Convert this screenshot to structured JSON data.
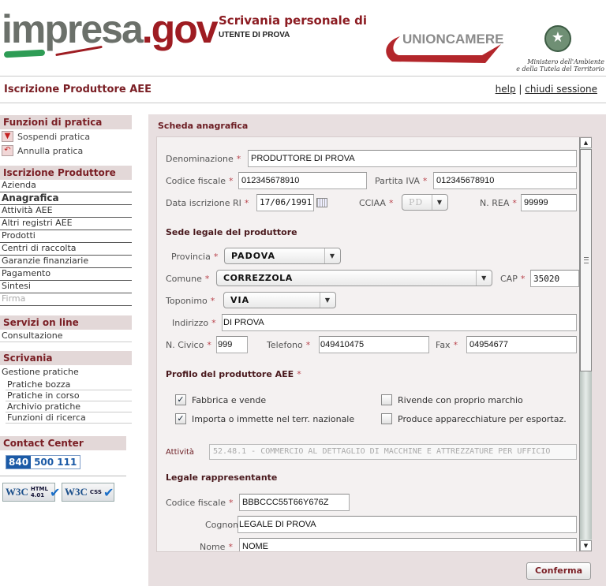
{
  "header": {
    "logo_part1": "impresa",
    "logo_part2": ".gov",
    "scrivania_title": "Scrivania personale di",
    "user_name": "UTENTE DI PROVA",
    "partner_logo": "UNIONCAMERE",
    "ministry_line1": "Ministero dell'Ambiente",
    "ministry_line2": "e della Tutela del Territorio",
    "ministry_emblem": "italian-republic-emblem"
  },
  "page_title": "Iscrizione Produttore AEE",
  "top_links": {
    "help": "help",
    "separator": "|",
    "logout": "chiudi sessione"
  },
  "sidebar": {
    "funzioni": {
      "title": "Funzioni di pratica",
      "actions": [
        {
          "label": "Sospendi pratica",
          "icon": "suspend-icon"
        },
        {
          "label": "Annulla pratica",
          "icon": "undo-icon"
        }
      ]
    },
    "iscrizione": {
      "title": "Iscrizione Produttore",
      "items": [
        {
          "label": "Azienda",
          "state": "normal"
        },
        {
          "label": "Anagrafica",
          "state": "active"
        },
        {
          "label": "Attività AEE",
          "state": "normal"
        },
        {
          "label": "Altri registri AEE",
          "state": "normal"
        },
        {
          "label": "Prodotti",
          "state": "normal"
        },
        {
          "label": "Centri di raccolta",
          "state": "normal"
        },
        {
          "label": "Garanzie finanziarie",
          "state": "normal"
        },
        {
          "label": "Pagamento",
          "state": "normal"
        },
        {
          "label": "Sintesi",
          "state": "normal"
        },
        {
          "label": "Firma",
          "state": "disabled"
        }
      ]
    },
    "servizi": {
      "title": "Servizi on line",
      "items": [
        "Consultazione"
      ]
    },
    "scrivania": {
      "title": "Scrivania",
      "group_label": "Gestione pratiche",
      "items": [
        "Pratiche bozza",
        "Pratiche in corso",
        "Archivio pratiche",
        "Funzioni di ricerca"
      ]
    },
    "contact": {
      "title": "Contact Center",
      "phone_prefix": "840",
      "phone_rest": "500 111"
    },
    "badges": [
      {
        "logo": "W3C",
        "text": "HTML 4.01"
      },
      {
        "logo": "W3C",
        "text": "CSS"
      }
    ]
  },
  "form": {
    "title": "Scheda anagrafica",
    "required_mark": "*",
    "fields": {
      "denominazione": {
        "label": "Denominazione",
        "value": "PRODUTTORE DI PROVA"
      },
      "codice_fiscale": {
        "label": "Codice fiscale",
        "value": "012345678910"
      },
      "partita_iva": {
        "label": "Partita IVA",
        "value": "012345678910"
      },
      "data_iscrizione": {
        "label": "Data iscrizione RI",
        "value": "17/06/1991"
      },
      "cciaa": {
        "label": "CCIAA",
        "value": "PD"
      },
      "n_rea": {
        "label": "N. REA",
        "value": "99999"
      }
    },
    "sede": {
      "title": "Sede legale del produttore",
      "provincia": {
        "label": "Provincia",
        "value": "PADOVA"
      },
      "comune": {
        "label": "Comune",
        "value": "CORREZZOLA"
      },
      "cap": {
        "label": "CAP",
        "value": "35020"
      },
      "toponimo": {
        "label": "Toponimo",
        "value": "VIA"
      },
      "indirizzo": {
        "label": "Indirizzo",
        "value": "DI PROVA"
      },
      "civico": {
        "label": "N. Civico",
        "value": "999"
      },
      "telefono": {
        "label": "Telefono",
        "value": "049410475"
      },
      "fax": {
        "label": "Fax",
        "value": "04954677"
      }
    },
    "profilo": {
      "title": "Profilo del produttore AEE",
      "options": [
        {
          "label": "Fabbrica e vende",
          "checked": true
        },
        {
          "label": "Importa o immette nel terr. nazionale",
          "checked": true
        },
        {
          "label": "Rivende con proprio marchio",
          "checked": false
        },
        {
          "label": "Produce apparecchiature per esportaz.",
          "checked": false
        }
      ],
      "attivita_label": "Attività",
      "attivita_value": "52.48.1 - COMMERCIO AL DETTAGLIO DI MACCHINE E ATTREZZATURE PER UFFICIO"
    },
    "legale": {
      "title": "Legale rappresentante",
      "codice_fiscale": {
        "label": "Codice fiscale",
        "value": "BBBCCC55T66Y676Z"
      },
      "cognome": {
        "label": "Cognome",
        "value": "LEGALE DI PROVA"
      },
      "nome": {
        "label": "Nome",
        "value": "NOME"
      }
    },
    "confirm_button": "Conferma"
  },
  "colors": {
    "brand_red": "#9e1c22",
    "brand_gray": "#6b706a",
    "panel_bg": "#e8dfe0",
    "section_head_bg": "#e3d8d8"
  }
}
